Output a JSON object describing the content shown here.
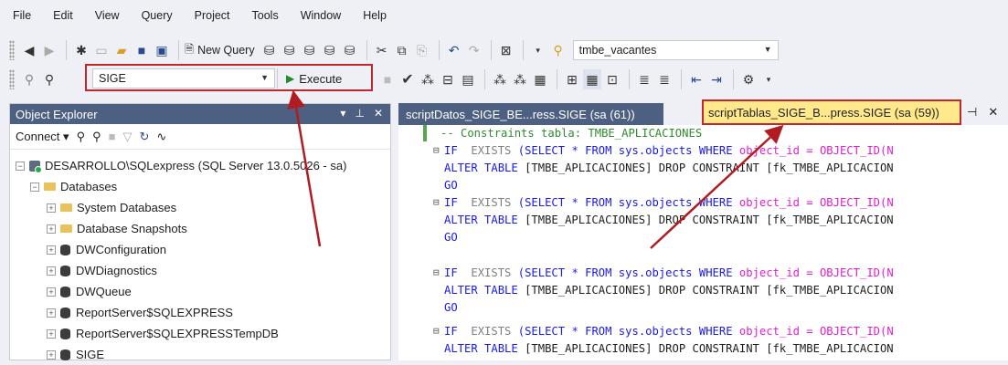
{
  "menu": [
    "File",
    "Edit",
    "View",
    "Query",
    "Project",
    "Tools",
    "Window",
    "Help"
  ],
  "toolbar": {
    "new_query_label": "New Query",
    "db_select_value": "tmbe_vacantes",
    "database_combo_value": "SIGE",
    "execute_label": "Execute"
  },
  "object_explorer": {
    "title": "Object Explorer",
    "connect_label": "Connect",
    "server_node": "DESARROLLO\\SQLexpress (SQL Server 13.0.5026 - sa)",
    "databases_label": "Databases",
    "items": [
      "System Databases",
      "Database Snapshots",
      "DWConfiguration",
      "DWDiagnostics",
      "DWQueue",
      "ReportServer$SQLEXPRESS",
      "ReportServer$SQLEXPRESSTempDB",
      "SIGE"
    ]
  },
  "tabs": {
    "tab1": "scriptDatos_SIGE_BE...ress.SIGE (sa (61))",
    "tab2": "scriptTablas_SIGE_B...press.SIGE (sa (59))"
  },
  "editor": {
    "comment": "-- Constraints tabla: TMBE_APLICACIONES",
    "if_kw": "IF",
    "exists_rest": "EXISTS",
    "select_part": "(SELECT * FROM sys.objects WHERE",
    "object_id_part": "object_id = OBJECT_ID(N",
    "alter_kw": "ALTER TABLE",
    "alter_rest": "[TMBE_APLICACIONES] DROP CONSTRAINT [fk_TMBE_APLICACION",
    "go": "GO"
  },
  "colors": {
    "accent_header": "#4d6082",
    "highlight_box": "#c0282d",
    "active_tab": "#ffe98b",
    "keyword": "#1a1ae8",
    "comment": "#2e8b2e"
  }
}
